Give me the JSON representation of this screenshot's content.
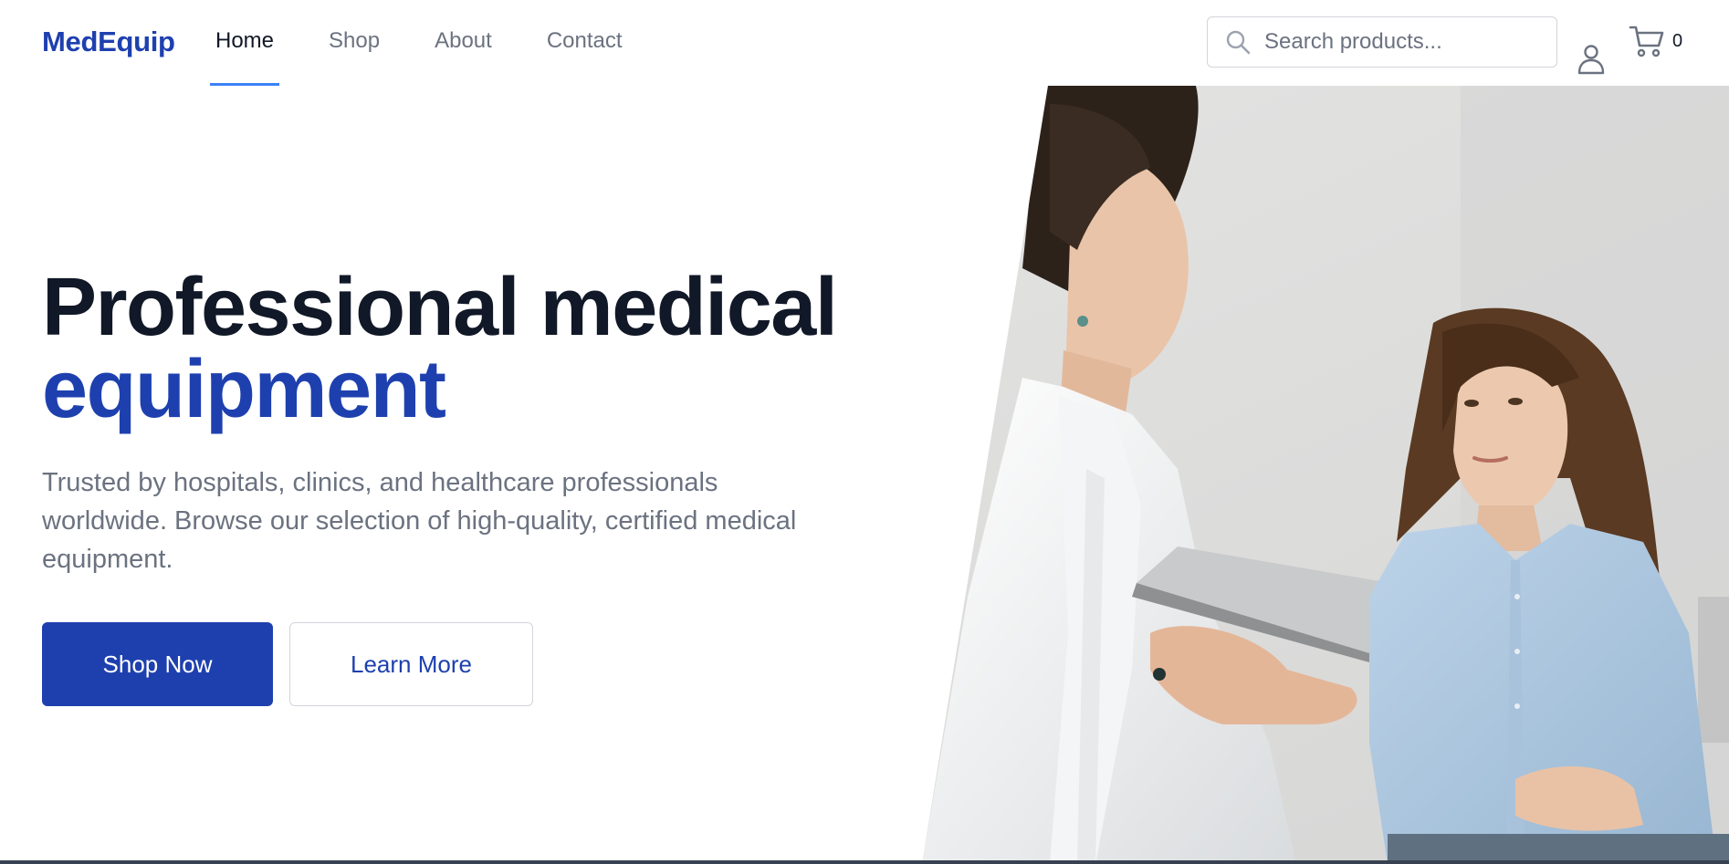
{
  "brand": {
    "name": "MedEquip",
    "color": "#1e40af"
  },
  "nav": {
    "items": [
      {
        "label": "Home",
        "active": true
      },
      {
        "label": "Shop",
        "active": false
      },
      {
        "label": "About",
        "active": false
      },
      {
        "label": "Contact",
        "active": false
      }
    ],
    "active_indicator_color": "#3b82f6"
  },
  "search": {
    "placeholder": "Search products...",
    "value": "",
    "icon": "search-icon"
  },
  "account": {
    "icon": "user-icon"
  },
  "cart": {
    "icon": "cart-icon",
    "count": "0"
  },
  "hero": {
    "headline_line1": "Professional medical",
    "headline_line2": "equipment",
    "subtext": "Trusted by hospitals, clinics, and healthcare professionals worldwide. Browse our selection of high-quality, certified medical equipment.",
    "primary_cta": "Shop Now",
    "secondary_cta": "Learn More",
    "image_subject": "doctor-consulting-patient-photo"
  },
  "colors": {
    "primary": "#1e40af",
    "text_dark": "#111827",
    "text_muted": "#6b7280",
    "border": "#d1d5db"
  }
}
